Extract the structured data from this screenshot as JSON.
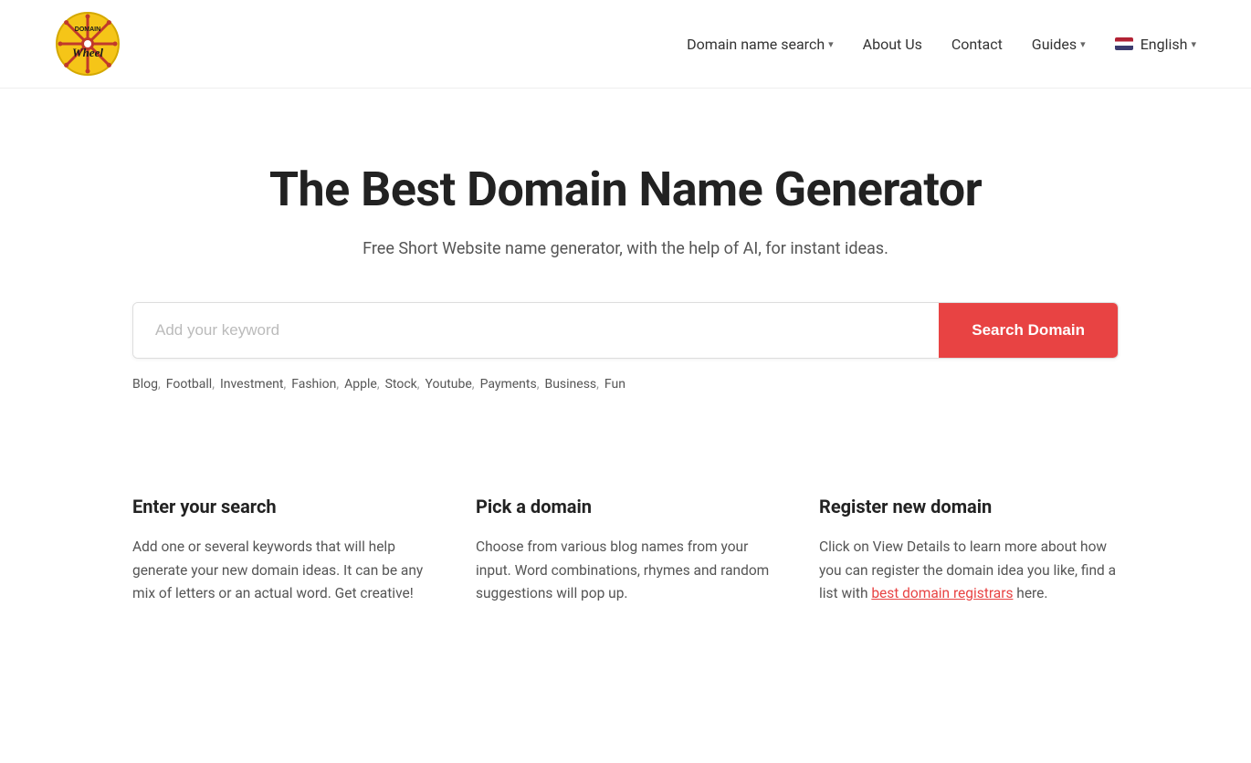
{
  "header": {
    "logo_alt": "Domain Wheel Logo",
    "nav": {
      "domain_search_label": "Domain name search",
      "about_label": "About Us",
      "contact_label": "Contact",
      "guides_label": "Guides",
      "english_label": "English"
    }
  },
  "hero": {
    "title": "The Best Domain Name Generator",
    "subtitle": "Free Short Website name generator, with the help of AI, for instant ideas."
  },
  "search": {
    "placeholder": "Add your keyword",
    "button_label": "Search Domain",
    "tags": [
      "Blog",
      "Football",
      "Investment",
      "Fashion",
      "Apple",
      "Stock",
      "Youtube",
      "Payments",
      "Business",
      "Fun"
    ]
  },
  "info": {
    "cards": [
      {
        "title": "Enter your search",
        "body": "Add one or several keywords that will help generate your new domain ideas. It can be any mix of letters or an actual word. Get creative!"
      },
      {
        "title": "Pick a domain",
        "body": "Choose from various blog names from your input. Word combinations, rhymes and random suggestions will pop up."
      },
      {
        "title": "Register new domain",
        "body_pre": "Click on View Details to learn more about how you can register the domain idea you like, find a list with ",
        "link_text": "best domain registrars",
        "link_href": "#",
        "body_post": " here."
      }
    ]
  }
}
